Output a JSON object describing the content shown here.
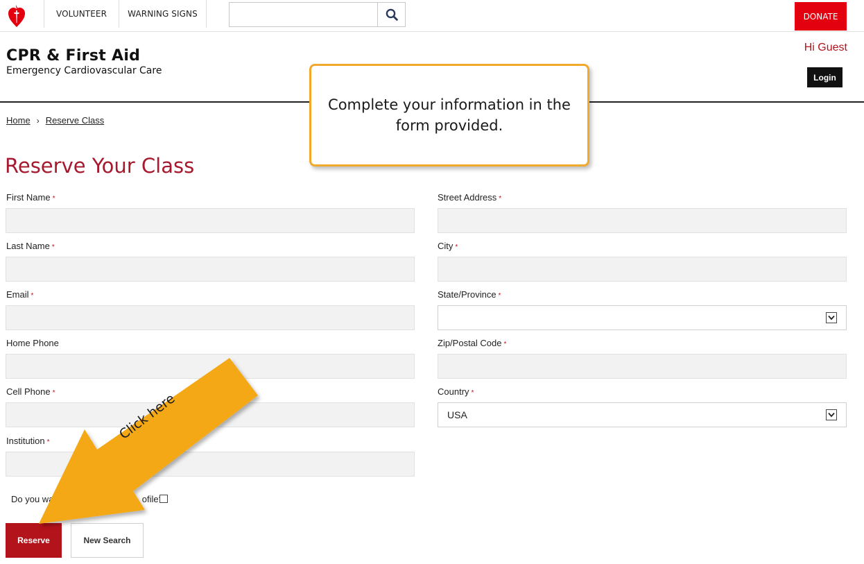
{
  "topnav": {
    "items": [
      "VOLUNTEER",
      "WARNING SIGNS"
    ],
    "search_placeholder": "",
    "donate_label": "DONATE"
  },
  "header": {
    "title": "CPR & First Aid",
    "subtitle": "Emergency Cardiovascular Care",
    "greeting": "Hi Guest",
    "login_label": "Login"
  },
  "breadcrumb": {
    "home": "Home",
    "separator": "›",
    "current": "Reserve Class"
  },
  "page": {
    "title": "Reserve Your Class"
  },
  "form": {
    "required_marker": "*",
    "left": [
      {
        "label": "First Name",
        "required": true,
        "value": ""
      },
      {
        "label": "Last Name",
        "required": true,
        "value": ""
      },
      {
        "label": "Email",
        "required": true,
        "value": ""
      },
      {
        "label": "Home Phone",
        "required": false,
        "value": ""
      },
      {
        "label": "Cell Phone",
        "required": true,
        "value": ""
      },
      {
        "label": "Institution",
        "required": true,
        "value": ""
      }
    ],
    "right": [
      {
        "label": "Street Address",
        "required": true,
        "type": "text",
        "value": ""
      },
      {
        "label": "City",
        "required": true,
        "type": "text",
        "value": ""
      },
      {
        "label": "State/Province",
        "required": true,
        "type": "select",
        "value": ""
      },
      {
        "label": "Zip/Postal Code",
        "required": true,
        "type": "text",
        "value": ""
      },
      {
        "label": "Country",
        "required": true,
        "type": "select",
        "value": "USA"
      }
    ],
    "profile_question_left": "Do you war",
    "profile_question_right": "ofile?",
    "reserve_label": "Reserve",
    "new_search_label": "New Search"
  },
  "annotations": {
    "callout_text": "Complete your information in the form provided.",
    "arrow_text": "Click here",
    "callout_border": "#f0a92d",
    "arrow_fill": "#f5a814"
  },
  "colors": {
    "brand_red": "#b3131b",
    "donate_red": "#e3000f",
    "title_red": "#a6192e"
  },
  "icons": {
    "logo": "heart-torch-logo",
    "search": "magnifier-icon",
    "select": "chevron-down-icon"
  }
}
